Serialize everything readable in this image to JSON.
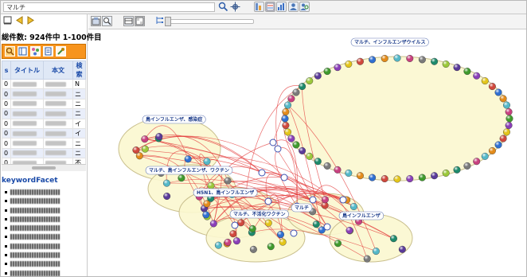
{
  "toolbar": {
    "search_value": "マルチ",
    "icons": [
      "search-icon",
      "settings-icon",
      "filter-icon",
      "export-icon",
      "chart-icon",
      "user-icon",
      "user-search-icon"
    ]
  },
  "left_panel": {
    "nav": {
      "icons": [
        "home-icon",
        "back-icon",
        "forward-icon"
      ]
    },
    "result_count": "総件数: 924件中 1-100件目",
    "tools": [
      "search-tool",
      "list-tool",
      "network-tool",
      "document-tool",
      "settings-tool"
    ],
    "table": {
      "headers": [
        "s",
        "タイトル",
        "本文",
        "検索"
      ],
      "rows": [
        {
          "s": "0",
          "last": "N"
        },
        {
          "s": "0",
          "last": "ニ"
        },
        {
          "s": "0",
          "last": "ニ"
        },
        {
          "s": "0",
          "last": "ニ"
        },
        {
          "s": "0",
          "last": "イ"
        },
        {
          "s": "0",
          "last": "イ"
        },
        {
          "s": "0",
          "last": "ニ"
        },
        {
          "s": "0",
          "last": "ニ"
        },
        {
          "s": "0",
          "last": "不"
        }
      ]
    },
    "facet": {
      "title": "keywordFacet",
      "items": [
        "",
        "",
        "",
        "",
        "",
        "",
        "",
        "",
        "",
        "",
        ""
      ]
    }
  },
  "graph_area": {
    "toolbar_icons": [
      "layout-icon",
      "zoom-icon",
      "network-icon",
      "table-icon",
      "tree-icon"
    ],
    "clusters": [
      {
        "id": "c1",
        "label": "マルチ、インフルエンザウイルス"
      },
      {
        "id": "c2",
        "label": "鳥インフルエンザ、感染症"
      },
      {
        "id": "c3",
        "label": "マルチ、鳥インフルエンザ、ワクチン"
      },
      {
        "id": "c4",
        "label": "H5N1、鳥インフルエンザ"
      },
      {
        "id": "c5",
        "label": "マルチ、不活化ワクチン"
      },
      {
        "id": "c6",
        "label": "マルチ"
      },
      {
        "id": "c7",
        "label": "鳥インフルエンザ"
      }
    ]
  },
  "colors": {
    "accent_orange": "#f7941d",
    "link_blue": "#1a4aa8",
    "cluster_fill": "#fbf7cf",
    "cluster_stroke": "#c9bf8d",
    "edge_red": "#e33b3b"
  }
}
